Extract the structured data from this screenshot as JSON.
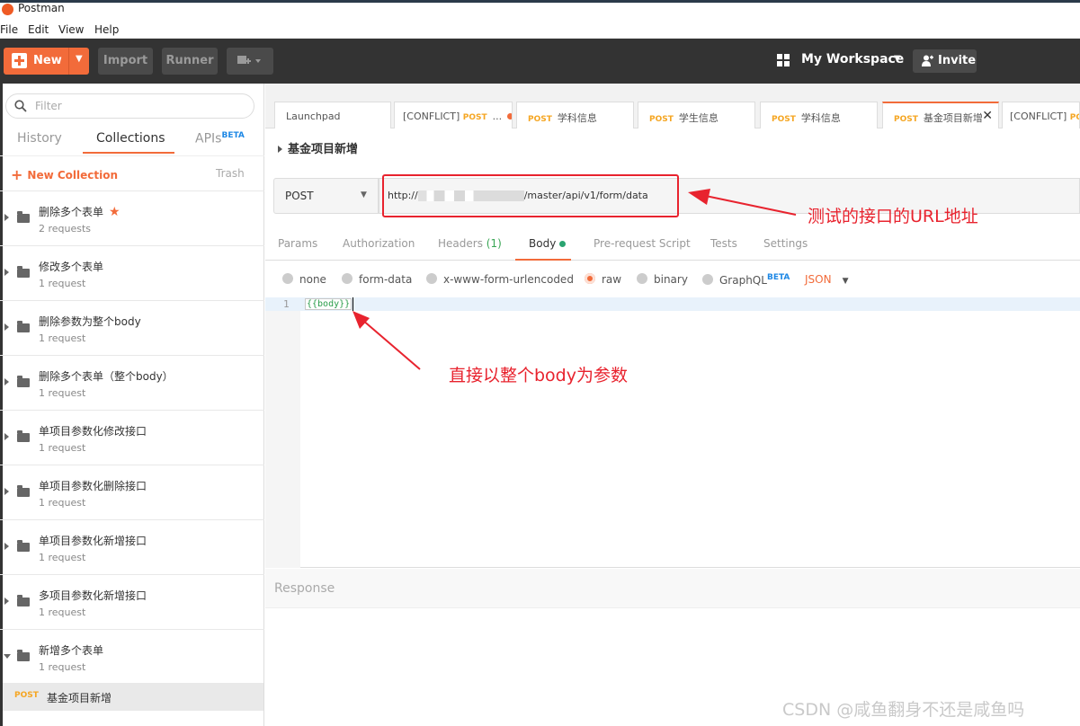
{
  "window": {
    "title": "Postman"
  },
  "menu": {
    "items": [
      "File",
      "Edit",
      "View",
      "Help"
    ]
  },
  "toolbar": {
    "new_label": "New",
    "import_label": "Import",
    "runner_label": "Runner",
    "workspace_label": "My Workspace",
    "invite_label": "Invite"
  },
  "sidebar": {
    "filter_placeholder": "Filter",
    "tabs": {
      "history": "History",
      "collections": "Collections",
      "apis": "APIs",
      "apis_badge": "BETA"
    },
    "new_collection": "New Collection",
    "trash": "Trash",
    "collections": [
      {
        "name": "删除多个表单",
        "count": "2 requests",
        "starred": true
      },
      {
        "name": "修改多个表单",
        "count": "1 request"
      },
      {
        "name": "删除参数为整个body",
        "count": "1 request"
      },
      {
        "name": "删除多个表单（整个body）",
        "count": "1 request"
      },
      {
        "name": "单项目参数化修改接口",
        "count": "1 request"
      },
      {
        "name": "单项目参数化删除接口",
        "count": "1 request"
      },
      {
        "name": "单项目参数化新增接口",
        "count": "1 request"
      },
      {
        "name": "多项目参数化新增接口",
        "count": "1 request"
      },
      {
        "name": "新增多个表单",
        "count": "1 request"
      }
    ],
    "open_request": {
      "method": "POST",
      "name": "基金项目新增"
    }
  },
  "tabs": [
    {
      "label": "Launchpad"
    },
    {
      "prefix": "[CONFLICT]",
      "method": "POST",
      "label": "...",
      "dirty": true
    },
    {
      "method": "POST",
      "label": "学科信息"
    },
    {
      "method": "POST",
      "label": "学生信息"
    },
    {
      "method": "POST",
      "label": "学科信息"
    },
    {
      "method": "POST",
      "label": "基金项目新增",
      "active": true
    },
    {
      "prefix": "[CONFLICT]",
      "method": "PO",
      "label": ""
    }
  ],
  "request": {
    "breadcrumb": "基金项目新增",
    "method": "POST",
    "url_prefix": "http://",
    "url_suffix": "/master/api/v1/form/data",
    "tabs": [
      "Params",
      "Authorization",
      "Headers",
      "Body",
      "Pre-request Script",
      "Tests",
      "Settings"
    ],
    "headers_count": "(1)",
    "body_types": [
      "none",
      "form-data",
      "x-www-form-urlencoded",
      "raw",
      "binary",
      "GraphQL"
    ],
    "graphql_badge": "BETA",
    "selected_body_type": "raw",
    "format": "JSON",
    "editor_line_number": "1",
    "editor_content": "{{body}}"
  },
  "response": {
    "label": "Response"
  },
  "annotations": {
    "url_note": "测试的接口的URL地址",
    "body_note": "直接以整个body为参数",
    "color": "#e8232e"
  },
  "watermark": "CSDN @咸鱼翻身不还是咸鱼吗"
}
